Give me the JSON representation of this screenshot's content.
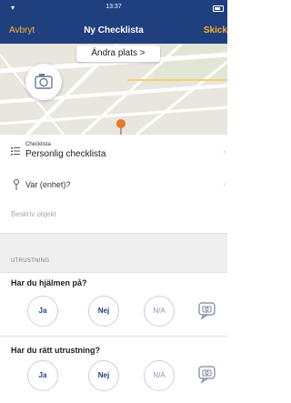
{
  "status_bar": {
    "time": "13:37"
  },
  "nav": {
    "cancel": "Avbryt",
    "title": "Ny Checklista",
    "send": "Skick"
  },
  "map": {
    "change_location": "Ändra plats >"
  },
  "checklist": {
    "caption": "Checklista",
    "value": "Personlig checklista"
  },
  "location": {
    "label": "Var (enhet)?"
  },
  "description": {
    "placeholder": "Beskriv objekt"
  },
  "section": {
    "title": "UTRUSTNING"
  },
  "questions": [
    {
      "text": "Har du hjälmen på?",
      "answers": [
        "Ja",
        "Nej",
        "N/A"
      ]
    },
    {
      "text": "Har du rätt utrustning?",
      "answers": [
        "Ja",
        "Nej",
        "N/A"
      ]
    }
  ],
  "colors": {
    "header_bg": "#1f3f7f",
    "accent": "#ffae2b",
    "pin": "#e8762c"
  }
}
